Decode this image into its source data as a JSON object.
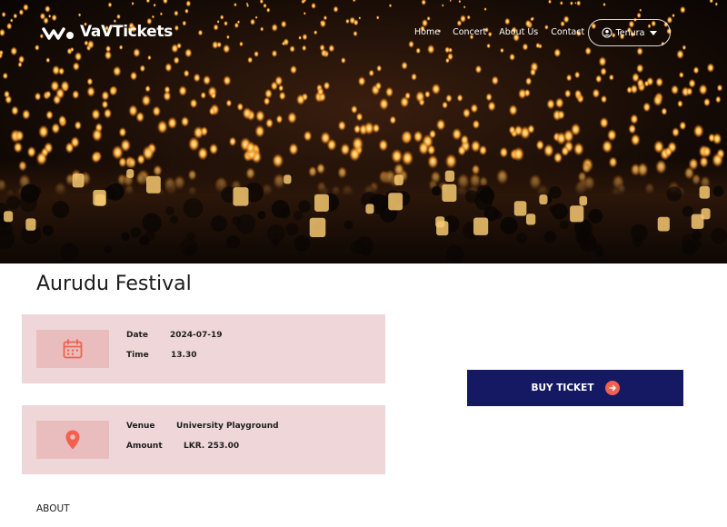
{
  "brand": {
    "name": "VaVTickets"
  },
  "nav": {
    "links": [
      "Home",
      "Concert",
      "About Us",
      "Contact"
    ],
    "user": "Tenura"
  },
  "event": {
    "title": "Aurudu Festival",
    "date_label": "Date",
    "date_value": "2024-07-19",
    "time_label": "Time",
    "time_value": "13.30",
    "venue_label": "Venue",
    "venue_value": "University Playground",
    "amount_label": "Amount",
    "amount_value": "LKR. 253.00"
  },
  "actions": {
    "buy_label": "BUY TICKET"
  },
  "sections": {
    "about_heading": "ABOUT"
  },
  "colors": {
    "accent": "#f2614d",
    "button": "#151963",
    "card": "#efd6d8",
    "icon_box": "#e9bdbe"
  }
}
